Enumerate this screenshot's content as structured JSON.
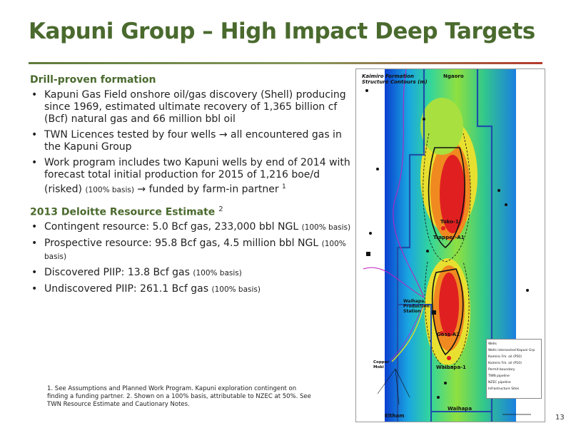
{
  "title": "Kapuni Group – High Impact Deep Targets",
  "section1": {
    "heading": "Drill-proven formation",
    "bullets": [
      {
        "text": "Kapuni Gas Field onshore oil/gas discovery (Shell) producing since 1969, estimated ultimate recovery of 1,365 billion cf (Bcf) natural gas and 66 million bbl oil"
      },
      {
        "text": "TWN Licences tested by four wells → all encountered gas in the Kapuni Group"
      },
      {
        "text": "Work program includes two Kapuni wells by end of 2014 with forecast total initial production for 2015 of 1,216 boe/d (risked)",
        "small": "(100% basis)",
        "after": "→ funded by farm-in partner",
        "sup": "1"
      }
    ]
  },
  "section2": {
    "heading": "2013 Deloitte Resource Estimate",
    "heading_sup": "2",
    "bullets": [
      {
        "text": "Contingent resource: 5.0 Bcf gas, 233,000 bbl NGL",
        "small": "(100% basis)"
      },
      {
        "text": "Prospective resource: 95.8 Bcf gas, 4.5 million bbl NGL",
        "small": "(100% basis)"
      },
      {
        "text": "Discovered PIIP: 13.8 Bcf gas",
        "small": "(100% basis)"
      },
      {
        "text": "Undiscovered PIIP: 261.1 Bcf gas",
        "small": "(100% basis)"
      }
    ]
  },
  "footnote": "1. See Assumptions and Planned Work Program. Kapuni exploration contingent on finding a funding partner. 2. Shown on a 100% basis, attributable to NZEC at 50%. See TWN Resource Estimate and Cautionary Notes.",
  "page_number": "13",
  "map": {
    "title_line1": "Kaimiro Formation",
    "title_line2": "Structure Contours (m)",
    "labels": {
      "ngaoro": "Ngaoro",
      "toko": "Toko-1",
      "trapper": "Trapper-A1",
      "waihapa_station": "Waihapa Production Station",
      "goss": "Goss-A2",
      "waihapa1": "Waihapa-1",
      "copper": "Copper Moki",
      "eltham": "Eltham",
      "waihapa": "Waihapa"
    },
    "legend": [
      "Wells",
      "Wells intersected Kapuni Grp",
      "Kaimiro Fm. oil (P50)",
      "Kaimiro Fm. oil (P10)",
      "Permit boundary",
      "TWN pipeline",
      "NZEC pipeline",
      "Infrastructure Sites"
    ]
  }
}
